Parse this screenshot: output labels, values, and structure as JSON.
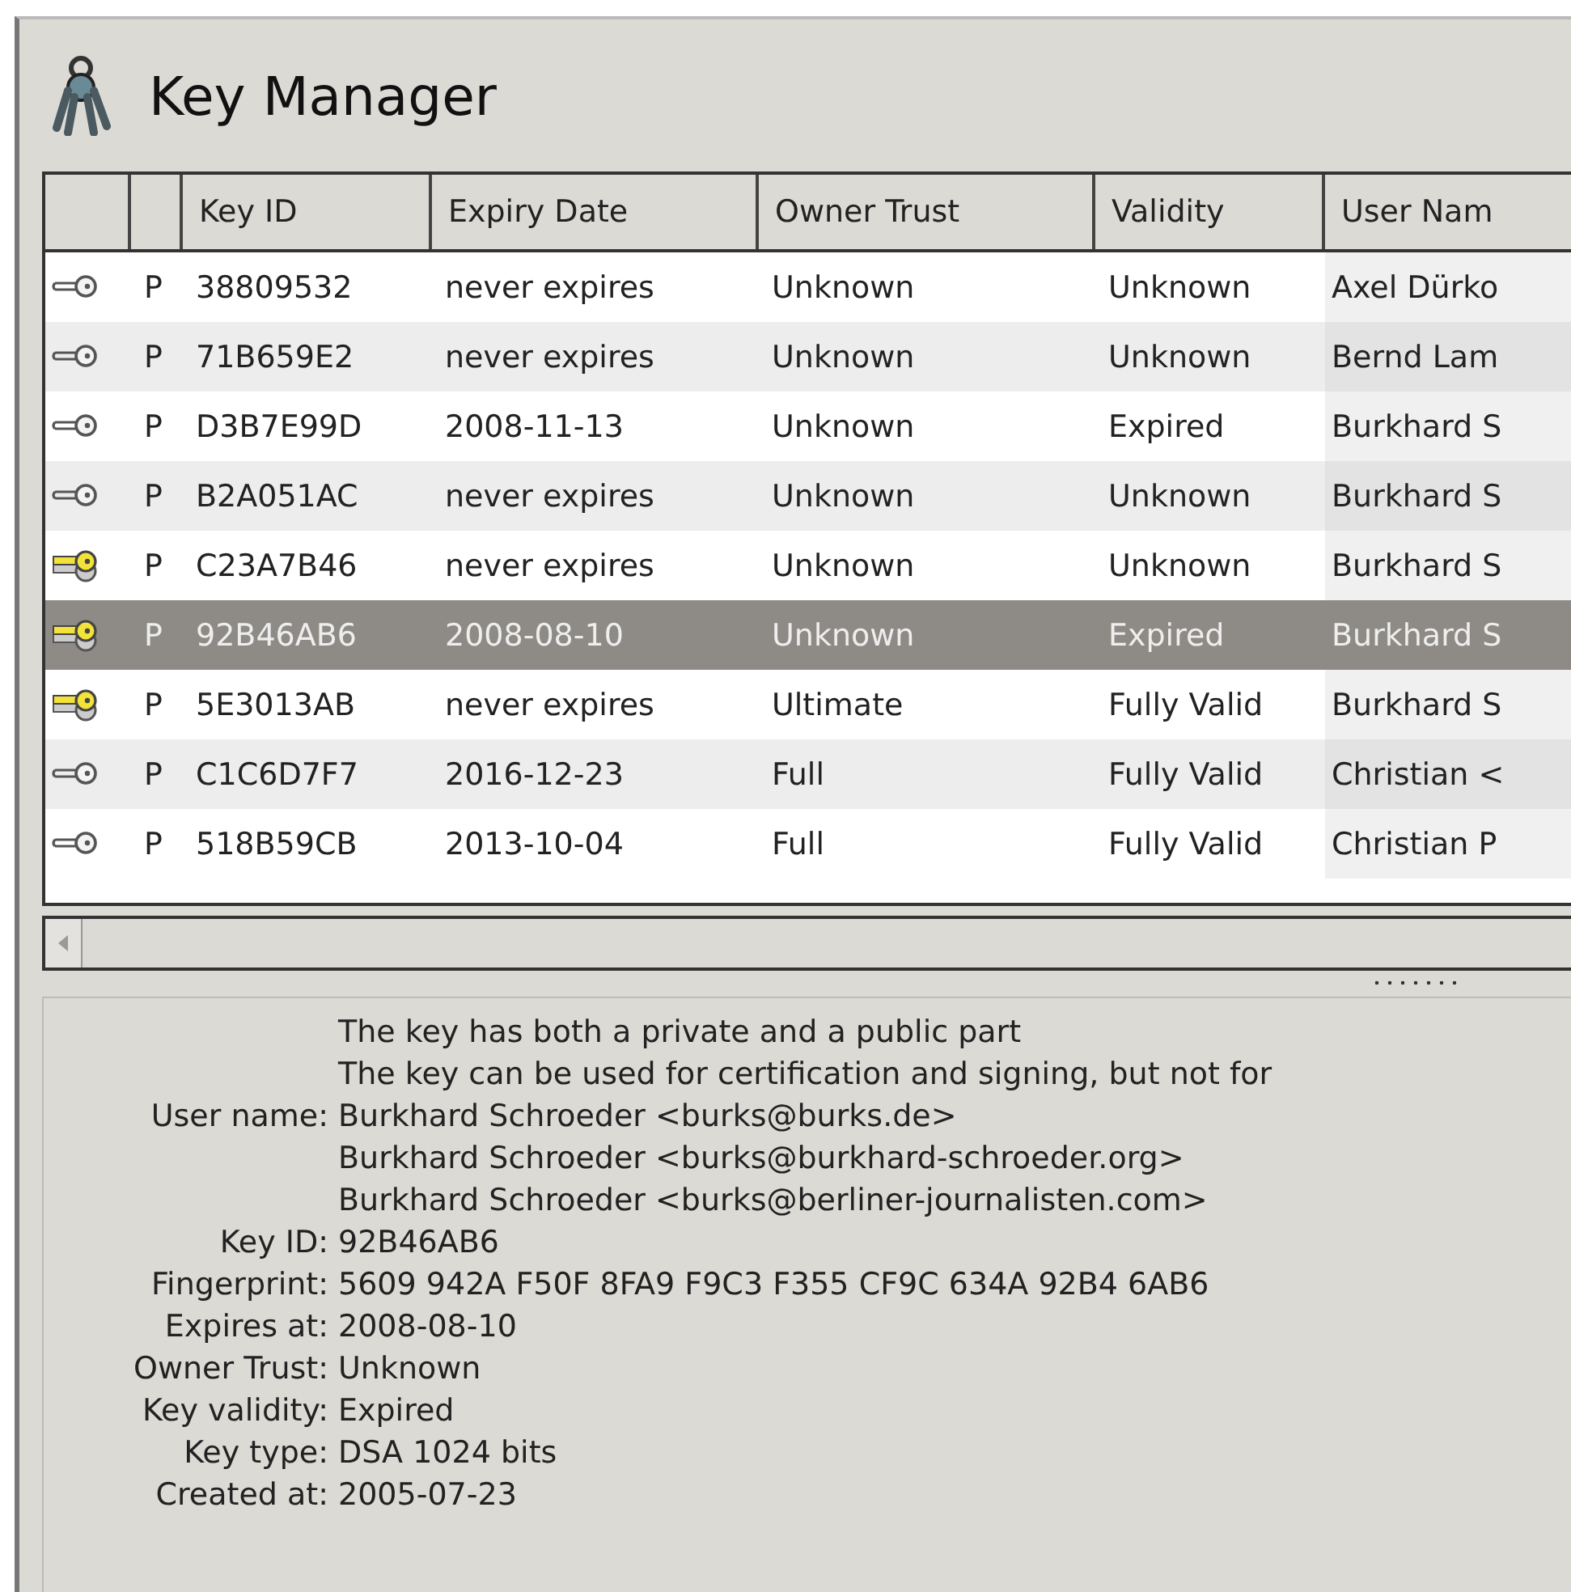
{
  "window": {
    "title": "Key Manager"
  },
  "table": {
    "columns": [
      "",
      "",
      "Key ID",
      "Expiry Date",
      "Owner Trust",
      "Validity",
      "User Nam"
    ],
    "rows": [
      {
        "kind": "public",
        "type": "P",
        "key_id": "38809532",
        "expiry": "never expires",
        "owner_trust": "Unknown",
        "validity": "Unknown",
        "user_name": "Axel Dürko",
        "selected": false
      },
      {
        "kind": "public",
        "type": "P",
        "key_id": "71B659E2",
        "expiry": "never expires",
        "owner_trust": "Unknown",
        "validity": "Unknown",
        "user_name": "Bernd Lam",
        "selected": false
      },
      {
        "kind": "public",
        "type": "P",
        "key_id": "D3B7E99D",
        "expiry": "2008-11-13",
        "owner_trust": "Unknown",
        "validity": "Expired",
        "user_name": "Burkhard S",
        "selected": false
      },
      {
        "kind": "public",
        "type": "P",
        "key_id": "B2A051AC",
        "expiry": "never expires",
        "owner_trust": "Unknown",
        "validity": "Unknown",
        "user_name": "Burkhard S",
        "selected": false
      },
      {
        "kind": "pair",
        "type": "P",
        "key_id": "C23A7B46",
        "expiry": "never expires",
        "owner_trust": "Unknown",
        "validity": "Unknown",
        "user_name": "Burkhard S",
        "selected": false
      },
      {
        "kind": "pair",
        "type": "P",
        "key_id": "92B46AB6",
        "expiry": "2008-08-10",
        "owner_trust": "Unknown",
        "validity": "Expired",
        "user_name": "Burkhard S",
        "selected": true
      },
      {
        "kind": "pair",
        "type": "P",
        "key_id": "5E3013AB",
        "expiry": "never expires",
        "owner_trust": "Ultimate",
        "validity": "Fully Valid",
        "user_name": "Burkhard S",
        "selected": false
      },
      {
        "kind": "public",
        "type": "P",
        "key_id": "C1C6D7F7",
        "expiry": "2016-12-23",
        "owner_trust": "Full",
        "validity": "Fully Valid",
        "user_name": "Christian <",
        "selected": false
      },
      {
        "kind": "public",
        "type": "P",
        "key_id": "518B59CB",
        "expiry": "2013-10-04",
        "owner_trust": "Full",
        "validity": "Fully Valid",
        "user_name": "Christian P",
        "selected": false
      }
    ]
  },
  "details": [
    {
      "value": "The key has both a private and a public part"
    },
    {
      "value": "The key can be used for certification and signing, but not for"
    },
    {
      "label": "User name:",
      "value": "Burkhard Schroeder <burks@burks.de>"
    },
    {
      "value": "Burkhard Schroeder <burks@burkhard-schroeder.org>"
    },
    {
      "value": "Burkhard Schroeder <burks@berliner-journalisten.com>"
    },
    {
      "label": "Key ID:",
      "value": "92B46AB6"
    },
    {
      "label": "Fingerprint:",
      "value": "5609 942A F50F 8FA9 F9C3  F355 CF9C 634A 92B4 6AB6"
    },
    {
      "label": "Expires at:",
      "value": "2008-08-10"
    },
    {
      "label": "Owner Trust:",
      "value": "Unknown"
    },
    {
      "label": "Key validity:",
      "value": "Expired"
    },
    {
      "label": "Key type:",
      "value": "DSA 1024 bits"
    },
    {
      "label": "Created at:",
      "value": "2005-07-23"
    }
  ]
}
